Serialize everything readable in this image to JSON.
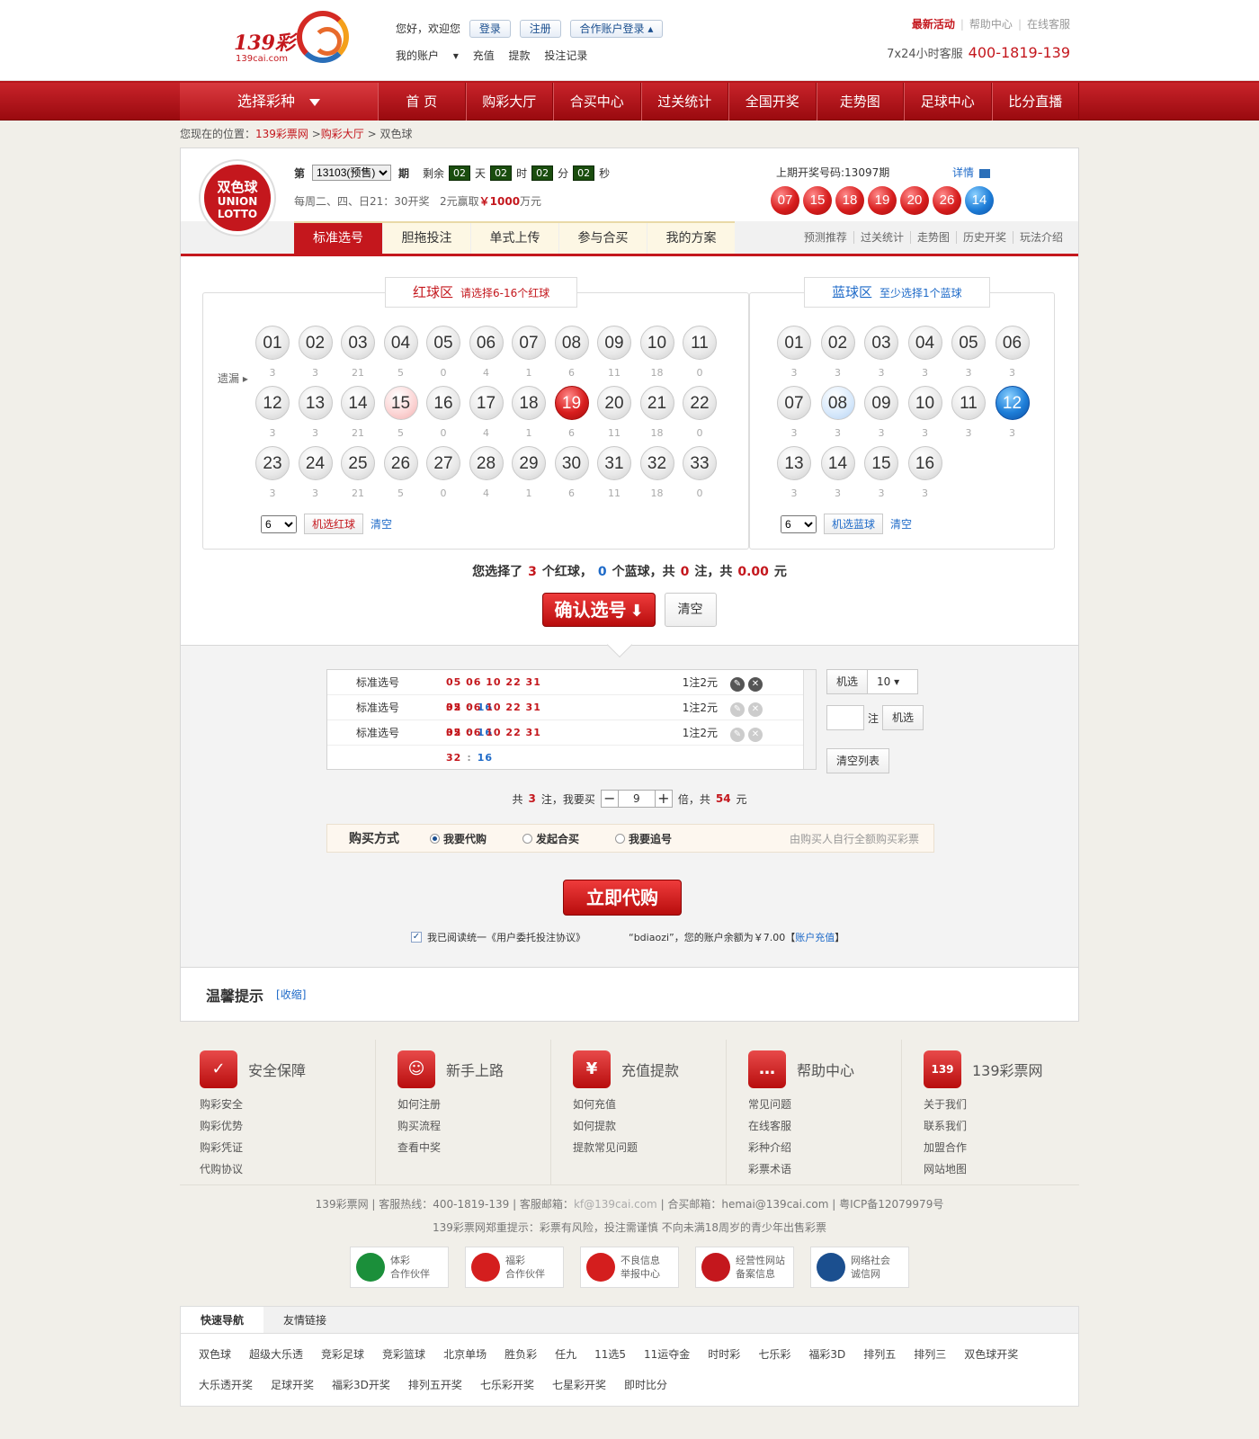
{
  "header": {
    "logo_text": "139彩",
    "logo_sub": "139cai.com",
    "greeting": "您好，欢迎您",
    "login": "登录",
    "register": "注册",
    "partner_login": "合作账户登录",
    "my_account": "我的账户",
    "recharge": "充值",
    "withdraw": "提款",
    "bet_record": "投注记录",
    "hot_activity": "最新活动",
    "help_center": "帮助中心",
    "online_service": "在线客服",
    "service_label": "7x24小时客服",
    "service_phone": "400-1819-139"
  },
  "nav": {
    "select_lottery": "选择彩种",
    "items": [
      "首 页",
      "购彩大厅",
      "合买中心",
      "过关统计",
      "全国开奖",
      "走势图",
      "足球中心",
      "比分直播"
    ]
  },
  "breadcrumb": {
    "prefix": "您现在的位置：",
    "site": "139彩票网",
    "hall": "购彩大厅",
    "current": "双色球"
  },
  "lottery": {
    "logo_l1": "双色球",
    "logo_l2": "UNION",
    "logo_l3": "LOTTO",
    "issue_prefix": "第",
    "issue": "13103(预售)",
    "issue_suffix": "期",
    "remain": "剩余",
    "days": "02",
    "day_u": "天",
    "hours": "02",
    "hour_u": "时",
    "mins": "02",
    "min_u": "分",
    "secs": "02",
    "sec_u": "秒",
    "schedule": "每周二、四、日21：30开奖",
    "prize_pre": "2元赢取",
    "prize": "￥1000",
    "prize_suf": "万元",
    "last_label": "上期开奖号码:13097期",
    "detail": "详情",
    "last_red": [
      "07",
      "15",
      "18",
      "19",
      "20",
      "26"
    ],
    "last_blue": "14"
  },
  "tabs": [
    "标准选号",
    "胆拖投注",
    "单式上传",
    "参与合买",
    "我的方案"
  ],
  "head_links": [
    "预测推荐",
    "过关统计",
    "走势图",
    "历史开奖",
    "玩法介绍"
  ],
  "red_zone": {
    "title": "红球区",
    "hint": "请选择6-16个红球",
    "miss_label": "遗漏",
    "numbers": [
      "01",
      "02",
      "03",
      "04",
      "05",
      "06",
      "07",
      "08",
      "09",
      "10",
      "11",
      "12",
      "13",
      "14",
      "15",
      "16",
      "17",
      "18",
      "19",
      "20",
      "21",
      "22",
      "23",
      "24",
      "25",
      "26",
      "27",
      "28",
      "29",
      "30",
      "31",
      "32",
      "33"
    ],
    "miss": [
      "3",
      "3",
      "21",
      "5",
      "0",
      "4",
      "1",
      "6",
      "11",
      "18",
      "0",
      "3",
      "3",
      "21",
      "5",
      "0",
      "4",
      "1",
      "6",
      "11",
      "18",
      "0",
      "3",
      "3",
      "21",
      "5",
      "0",
      "4",
      "1",
      "6",
      "11",
      "18",
      "0"
    ],
    "selected": [
      "19"
    ],
    "hover": [
      "15"
    ],
    "count": "6",
    "random": "机选红球",
    "clear": "清空"
  },
  "blue_zone": {
    "title": "蓝球区",
    "hint": "至少选择1个蓝球",
    "numbers": [
      "01",
      "02",
      "03",
      "04",
      "05",
      "06",
      "07",
      "08",
      "09",
      "10",
      "11",
      "12",
      "13",
      "14",
      "15",
      "16"
    ],
    "miss": [
      "3",
      "3",
      "3",
      "3",
      "3",
      "3",
      "3",
      "3",
      "3",
      "3",
      "3",
      "3",
      "3",
      "3",
      "3",
      "3"
    ],
    "selected": [
      "12"
    ],
    "hover": [
      "08"
    ],
    "count": "6",
    "random": "机选蓝球",
    "clear": "清空"
  },
  "summary": {
    "s1": "您选择了",
    "red_count": "3",
    "s2": "个红球，",
    "blue_count": "0",
    "s3": "个蓝球，共",
    "bets": "0",
    "s4": "注，共",
    "amount": "0.00",
    "s5": "元"
  },
  "confirm": "确认选号",
  "confirm_clear": "清空",
  "cart": {
    "rows": [
      {
        "type": "标准选号",
        "red": "05  06  10  22  31  32",
        "blue": "16",
        "price": "1注2元"
      },
      {
        "type": "标准选号",
        "red": "05  06  10  22  31  32",
        "blue": "16",
        "price": "1注2元"
      },
      {
        "type": "标准选号",
        "red": "05  06  10  22  31  32",
        "blue": "16",
        "price": "1注2元"
      }
    ],
    "random": "机选",
    "random_count": "10",
    "unit": "注",
    "random2": "机选",
    "clear_list": "清空列表"
  },
  "multiple": {
    "m1": "共",
    "bets": "3",
    "m2": "注，我要买",
    "times": "9",
    "m3": "倍，共",
    "total": "54",
    "m4": "元"
  },
  "buy": {
    "title": "购买方式",
    "opt1": "我要代购",
    "opt2": "发起合买",
    "opt3": "我要追号",
    "note": "由购买人自行全额购买彩票"
  },
  "buy_now": "立即代购",
  "agree": {
    "text": "我已阅读统一《用户委托投注协议》",
    "account": "“bdiaozi”，您的账户余额为￥7.00【",
    "recharge": "账户充值",
    "end": "】"
  },
  "tips": {
    "title": "温馨提示",
    "collapse": "[收缩]"
  },
  "footer": {
    "cols": [
      {
        "title": "安全保障",
        "icon": "✓",
        "items": [
          "购彩安全",
          "购彩优势",
          "购彩凭证",
          "代购协议"
        ]
      },
      {
        "title": "新手上路",
        "icon": "☺",
        "items": [
          "如何注册",
          "购买流程",
          "查看中奖"
        ]
      },
      {
        "title": "充值提款",
        "icon": "¥",
        "items": [
          "如何充值",
          "如何提款",
          "提款常见问题"
        ]
      },
      {
        "title": "帮助中心",
        "icon": "…",
        "items": [
          "常见问题",
          "在线客服",
          "彩种介绍",
          "彩票术语"
        ]
      },
      {
        "title": "139彩票网",
        "icon": "139",
        "items": [
          "关于我们",
          "联系我们",
          "加盟合作",
          "网站地图"
        ]
      }
    ],
    "info1": "139彩票网 | 客服热线：400-1819-139 | 客服邮箱：",
    "mail": "kf@139cai.com",
    "info1b": " | 合买邮箱：hemai@139cai.com | 粤ICP备12079979号",
    "info2": "139彩票网郑重提示：彩票有风险，投注需谨慎  不向未满18周岁的青少年出售彩票",
    "badges": [
      {
        "l1": "体彩",
        "l2": "合作伙伴",
        "color": "#1b8f3a"
      },
      {
        "l1": "福彩",
        "l2": "合作伙伴",
        "color": "#d41e1e"
      },
      {
        "l1": "不良信息",
        "l2": "举报中心",
        "color": "#d41e1e"
      },
      {
        "l1": "经营性网站",
        "l2": "备案信息",
        "color": "#c4171d"
      },
      {
        "l1": "网络社会",
        "l2": "诚信网",
        "color": "#1b4f8f"
      }
    ],
    "qtabs": [
      "快速导航",
      "友情链接"
    ],
    "qlinks": [
      "双色球",
      "超级大乐透",
      "竞彩足球",
      "竞彩篮球",
      "北京单场",
      "胜负彩",
      "任九",
      "11选5",
      "11运夺金",
      "时时彩",
      "七乐彩",
      "福彩3D",
      "排列五",
      "排列三",
      "双色球开奖",
      "大乐透开奖",
      "足球开奖",
      "福彩3D开奖",
      "排列五开奖",
      "七乐彩开奖",
      "七星彩开奖",
      "即时比分"
    ]
  }
}
